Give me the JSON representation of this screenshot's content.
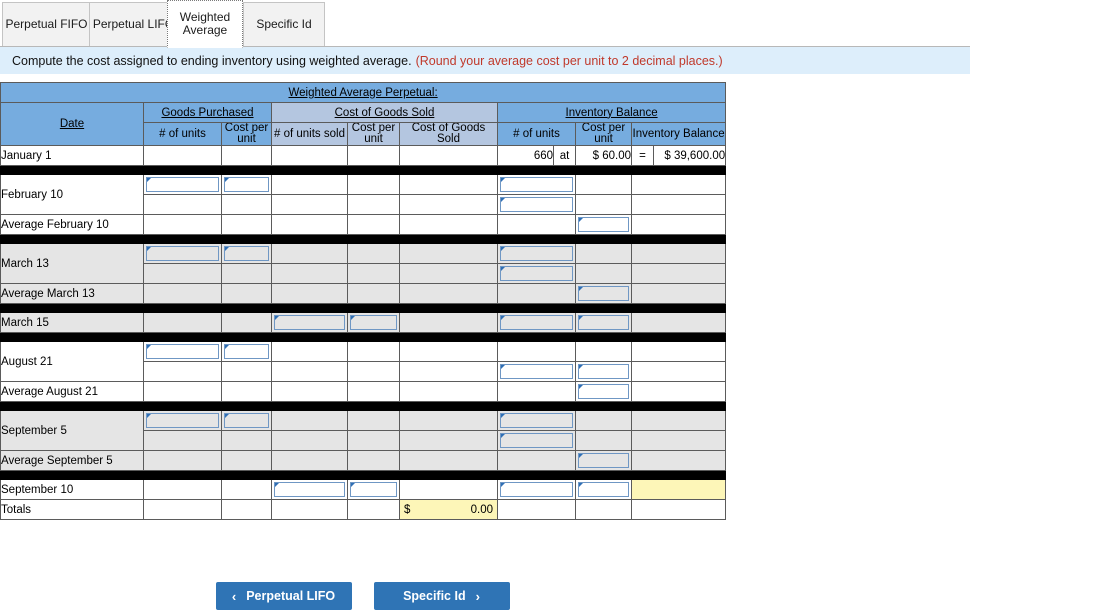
{
  "tabs": [
    {
      "label": "Perpetual FIFO",
      "active": false
    },
    {
      "label": "Perpetual LIFO",
      "active": false
    },
    {
      "label": "Weighted Average",
      "active": true
    },
    {
      "label": "Specific Id",
      "active": false
    }
  ],
  "instructions": {
    "text": "Compute the cost assigned to ending inventory using weighted average.",
    "hint": "(Round your average cost per unit to 2 decimal places.)"
  },
  "table": {
    "title": "Weighted Average Perpetual:",
    "group_headers": {
      "date": "Date",
      "goods_purchased": "Goods Purchased",
      "cost_of_goods_sold": "Cost of Goods Sold",
      "inventory_balance": "Inventory Balance"
    },
    "sub_headers": {
      "gp_units": "# of units",
      "gp_cost": "Cost per unit",
      "cogs_units": "# of units sold",
      "cogs_cost": "Cost per unit",
      "cogs_total": "Cost of Goods Sold",
      "ib_units": "# of units",
      "ib_cost": "Cost per unit",
      "ib_total": "Inventory Balance"
    },
    "rows": {
      "jan1": {
        "label": "January 1",
        "ib_units": "660",
        "op_at": "at",
        "ib_cost": "$ 60.00",
        "op_eq": "=",
        "ib_total": "$ 39,600.00"
      },
      "feb10": {
        "label": "February 10"
      },
      "avg_feb10": {
        "label": "Average February 10"
      },
      "mar13": {
        "label": "March 13"
      },
      "avg_mar13": {
        "label": "Average March 13"
      },
      "mar15": {
        "label": "March 15"
      },
      "aug21": {
        "label": "August 21"
      },
      "avg_aug21": {
        "label": "Average August 21"
      },
      "sep5": {
        "label": "September 5"
      },
      "avg_sep5": {
        "label": "Average September 5"
      },
      "sep10": {
        "label": "September 10"
      },
      "totals": {
        "label": "Totals",
        "cogs_currency": "$",
        "cogs_value": "0.00"
      }
    }
  },
  "footer": {
    "prev_button": "Perpetual LIFO",
    "next_button": "Specific Id",
    "prev_icon": "chevron-left-icon",
    "next_icon": "chevron-right-icon",
    "prev_chevron": "‹",
    "next_chevron": "›"
  },
  "colors": {
    "header_dark_blue": "#76acdf",
    "header_light_blue": "#b4c6e0",
    "instruction_bg": "#ddeefb",
    "hint_red": "#c0392b",
    "button_blue": "#2f74b5",
    "yellow_cell": "#fdf6b8",
    "shade_row": "#e5e5e5"
  }
}
